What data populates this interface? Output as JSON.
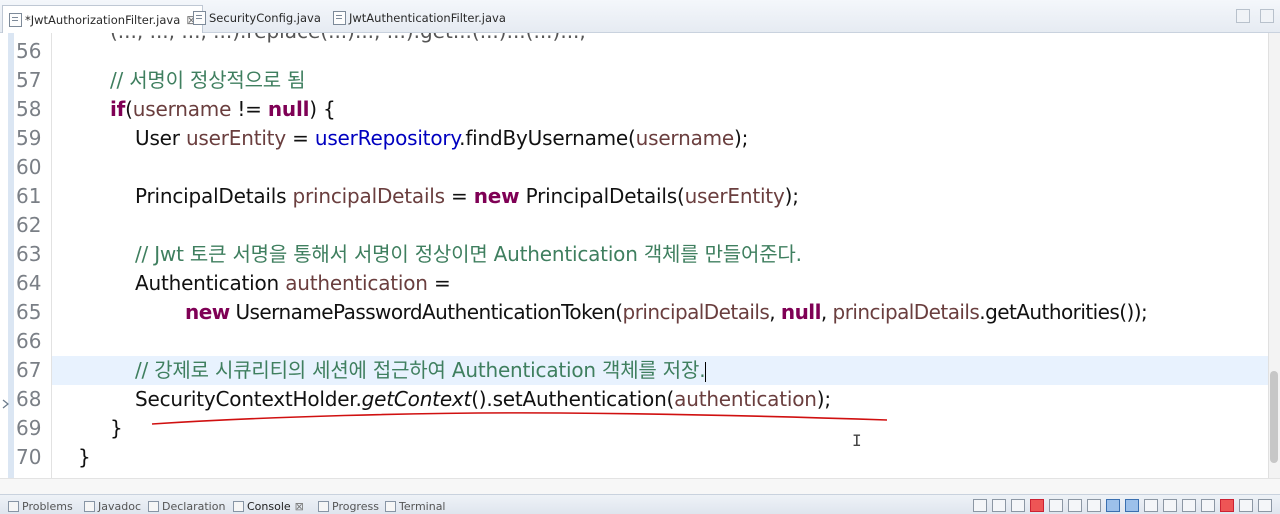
{
  "tabs": [
    {
      "label": "*JwtAuthorizationFilter.java",
      "close": "⊠",
      "active": true
    },
    {
      "label": "SecurityConfig.java",
      "active": false
    },
    {
      "label": "JwtAuthenticationFilter.java",
      "active": false
    }
  ],
  "editor": {
    "line_numbers": [
      "56",
      "57",
      "58",
      "59",
      "60",
      "61",
      "62",
      "63",
      "64",
      "65",
      "66",
      "67",
      "68",
      "69",
      "70"
    ],
    "current_line": "67",
    "lines": {
      "l57": "// 서명이 정상적으로 됨",
      "l58_if": "if",
      "l58_open": "(",
      "l58_username": "username",
      "l58_ne": " != ",
      "l58_null": "null",
      "l58_close": ") {",
      "l59_type": "User ",
      "l59_var": "userEntity",
      "l59_eq": " = ",
      "l59_field": "userRepository",
      "l59_call": ".findByUsername(",
      "l59_arg": "username",
      "l59_end": ");",
      "l61_type": "PrincipalDetails ",
      "l61_var": "principalDetails",
      "l61_eq": " = ",
      "l61_new": "new",
      "l61_ctor": " PrincipalDetails(",
      "l61_arg": "userEntity",
      "l61_end": ");",
      "l63": "// Jwt 토큰 서명을 통해서 서명이 정상이면 Authentication 객체를 만들어준다.",
      "l64_type": "Authentication ",
      "l64_var": "authentication",
      "l64_eq": " =",
      "l65_new": "new",
      "l65_ctor": " UsernamePasswordAuthenticationToken(",
      "l65_arg1": "principalDetails",
      "l65_sep1": ", ",
      "l65_null": "null",
      "l65_sep2": ", ",
      "l65_arg2": "principalDetails",
      "l65_end": ".getAuthorities());",
      "l67": "// 강제로 시큐리티의 세션에 접근하여 Authentication 객체를 저장.",
      "l68_class": "SecurityContextHolder.",
      "l68_static": "getContext",
      "l68_call": "().setAuthentication(",
      "l68_arg": "authentication",
      "l68_end": ");",
      "l69": "}",
      "l70": "}"
    }
  },
  "bottom_views": [
    {
      "label": "Problems"
    },
    {
      "label": "Javadoc"
    },
    {
      "label": "Declaration"
    },
    {
      "label": "Console",
      "close": "⊠",
      "active": true
    },
    {
      "label": "Progress"
    },
    {
      "label": "Terminal"
    }
  ],
  "colors": {
    "keyword": "#7f0055",
    "local_var": "#6a3e3e",
    "field": "#0000c0",
    "comment": "#3f7f5f",
    "current_line_bg": "#e8f2fe",
    "annotation_underline": "#d01010"
  }
}
